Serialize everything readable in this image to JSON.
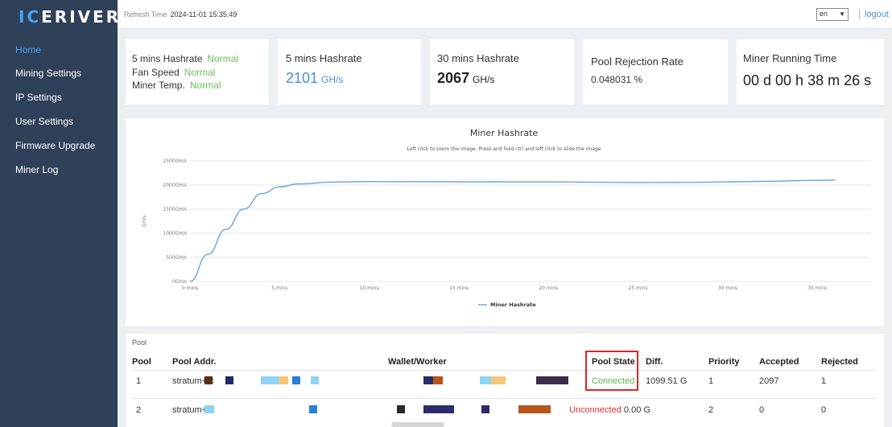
{
  "sidebar": {
    "logo_text": "ICERIVER",
    "items": [
      {
        "label": "Home",
        "active": true
      },
      {
        "label": "Mining Settings"
      },
      {
        "label": "IP Settings"
      },
      {
        "label": "User Settings"
      },
      {
        "label": "Firmware Upgrade"
      },
      {
        "label": "Miner Log"
      }
    ]
  },
  "topbar": {
    "refresh_label": "Refresh Time",
    "refresh_time": "2024-11-01 15:35:49",
    "language": "en",
    "logout_label": "logout"
  },
  "cards": {
    "status": {
      "hashrate_label": "5 mins Hashrate",
      "hashrate_status": "Normal",
      "fan_label": "Fan Speed",
      "fan_status": "Normal",
      "temp_label": "Miner Temp.",
      "temp_status": "Normal"
    },
    "hash5": {
      "title": "5 mins Hashrate",
      "value": "2101",
      "unit": "GH/s"
    },
    "hash30": {
      "title": "30 mins Hashrate",
      "value": "2067",
      "unit": "GH/s"
    },
    "rejection": {
      "title": "Pool Rejection Rate",
      "value": "0.048031 %"
    },
    "runtime": {
      "title": "Miner Running Time",
      "value": "00 d 00 h 38 m 26 s"
    }
  },
  "chart_data": {
    "type": "line",
    "title": "Miner Hashrate",
    "subtitle": "Left click to zoom the image. Press and hold ctrl and left click to slide the image",
    "ylabel": "GH/s",
    "xlabel": "",
    "x_ticks": [
      "0 mins",
      "5 mins",
      "10 mins",
      "15 mins",
      "20 mins",
      "25 mins",
      "30 mins",
      "35 mins"
    ],
    "y_ticks": [
      "0GH/s",
      "500GH/s",
      "1000GH/s",
      "1500GH/s",
      "2000GH/s",
      "2500GH/s"
    ],
    "ylim": [
      0,
      2500
    ],
    "xlim": [
      0,
      38
    ],
    "line_color": "#6fa8dc",
    "series": [
      {
        "name": "Miner Hashrate",
        "x": [
          0,
          1,
          2,
          3,
          4,
          5,
          6,
          8,
          10,
          12,
          15,
          18,
          20,
          22,
          25,
          28,
          30,
          32,
          35,
          36
        ],
        "y": [
          0,
          560,
          1080,
          1500,
          1820,
          1960,
          2020,
          2060,
          2070,
          2068,
          2065,
          2063,
          2062,
          2058,
          2050,
          2055,
          2062,
          2075,
          2095,
          2100
        ]
      }
    ],
    "legend": "bottom-center",
    "grid": true
  },
  "pool": {
    "section_label": "Pool",
    "headers": [
      "Pool",
      "Pool Addr.",
      "Wallet/Worker",
      "Pool State",
      "Diff.",
      "Priority",
      "Accepted",
      "Rejected"
    ],
    "rows": [
      {
        "pool": "1",
        "addr": "stratum+tc",
        "state": "Connected",
        "diff": "1099.51 G",
        "priority": "1",
        "accepted": "2097",
        "rejected": "1"
      },
      {
        "pool": "2",
        "addr": "stratum+tc",
        "state": "Unconnected",
        "diff": "0.00 G",
        "priority": "2",
        "accepted": "0",
        "rejected": "0"
      }
    ]
  }
}
